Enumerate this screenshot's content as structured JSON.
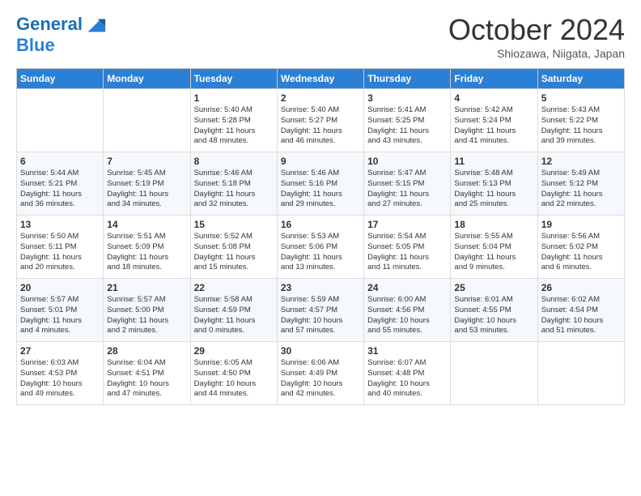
{
  "header": {
    "logo_line1": "General",
    "logo_line2": "Blue",
    "month": "October 2024",
    "location": "Shiozawa, Niigata, Japan"
  },
  "days_of_week": [
    "Sunday",
    "Monday",
    "Tuesday",
    "Wednesday",
    "Thursday",
    "Friday",
    "Saturday"
  ],
  "weeks": [
    [
      {
        "day": "",
        "info": ""
      },
      {
        "day": "",
        "info": ""
      },
      {
        "day": "1",
        "info": "Sunrise: 5:40 AM\nSunset: 5:28 PM\nDaylight: 11 hours\nand 48 minutes."
      },
      {
        "day": "2",
        "info": "Sunrise: 5:40 AM\nSunset: 5:27 PM\nDaylight: 11 hours\nand 46 minutes."
      },
      {
        "day": "3",
        "info": "Sunrise: 5:41 AM\nSunset: 5:25 PM\nDaylight: 11 hours\nand 43 minutes."
      },
      {
        "day": "4",
        "info": "Sunrise: 5:42 AM\nSunset: 5:24 PM\nDaylight: 11 hours\nand 41 minutes."
      },
      {
        "day": "5",
        "info": "Sunrise: 5:43 AM\nSunset: 5:22 PM\nDaylight: 11 hours\nand 39 minutes."
      }
    ],
    [
      {
        "day": "6",
        "info": "Sunrise: 5:44 AM\nSunset: 5:21 PM\nDaylight: 11 hours\nand 36 minutes."
      },
      {
        "day": "7",
        "info": "Sunrise: 5:45 AM\nSunset: 5:19 PM\nDaylight: 11 hours\nand 34 minutes."
      },
      {
        "day": "8",
        "info": "Sunrise: 5:46 AM\nSunset: 5:18 PM\nDaylight: 11 hours\nand 32 minutes."
      },
      {
        "day": "9",
        "info": "Sunrise: 5:46 AM\nSunset: 5:16 PM\nDaylight: 11 hours\nand 29 minutes."
      },
      {
        "day": "10",
        "info": "Sunrise: 5:47 AM\nSunset: 5:15 PM\nDaylight: 11 hours\nand 27 minutes."
      },
      {
        "day": "11",
        "info": "Sunrise: 5:48 AM\nSunset: 5:13 PM\nDaylight: 11 hours\nand 25 minutes."
      },
      {
        "day": "12",
        "info": "Sunrise: 5:49 AM\nSunset: 5:12 PM\nDaylight: 11 hours\nand 22 minutes."
      }
    ],
    [
      {
        "day": "13",
        "info": "Sunrise: 5:50 AM\nSunset: 5:11 PM\nDaylight: 11 hours\nand 20 minutes."
      },
      {
        "day": "14",
        "info": "Sunrise: 5:51 AM\nSunset: 5:09 PM\nDaylight: 11 hours\nand 18 minutes."
      },
      {
        "day": "15",
        "info": "Sunrise: 5:52 AM\nSunset: 5:08 PM\nDaylight: 11 hours\nand 15 minutes."
      },
      {
        "day": "16",
        "info": "Sunrise: 5:53 AM\nSunset: 5:06 PM\nDaylight: 11 hours\nand 13 minutes."
      },
      {
        "day": "17",
        "info": "Sunrise: 5:54 AM\nSunset: 5:05 PM\nDaylight: 11 hours\nand 11 minutes."
      },
      {
        "day": "18",
        "info": "Sunrise: 5:55 AM\nSunset: 5:04 PM\nDaylight: 11 hours\nand 9 minutes."
      },
      {
        "day": "19",
        "info": "Sunrise: 5:56 AM\nSunset: 5:02 PM\nDaylight: 11 hours\nand 6 minutes."
      }
    ],
    [
      {
        "day": "20",
        "info": "Sunrise: 5:57 AM\nSunset: 5:01 PM\nDaylight: 11 hours\nand 4 minutes."
      },
      {
        "day": "21",
        "info": "Sunrise: 5:57 AM\nSunset: 5:00 PM\nDaylight: 11 hours\nand 2 minutes."
      },
      {
        "day": "22",
        "info": "Sunrise: 5:58 AM\nSunset: 4:59 PM\nDaylight: 11 hours\nand 0 minutes."
      },
      {
        "day": "23",
        "info": "Sunrise: 5:59 AM\nSunset: 4:57 PM\nDaylight: 10 hours\nand 57 minutes."
      },
      {
        "day": "24",
        "info": "Sunrise: 6:00 AM\nSunset: 4:56 PM\nDaylight: 10 hours\nand 55 minutes."
      },
      {
        "day": "25",
        "info": "Sunrise: 6:01 AM\nSunset: 4:55 PM\nDaylight: 10 hours\nand 53 minutes."
      },
      {
        "day": "26",
        "info": "Sunrise: 6:02 AM\nSunset: 4:54 PM\nDaylight: 10 hours\nand 51 minutes."
      }
    ],
    [
      {
        "day": "27",
        "info": "Sunrise: 6:03 AM\nSunset: 4:53 PM\nDaylight: 10 hours\nand 49 minutes."
      },
      {
        "day": "28",
        "info": "Sunrise: 6:04 AM\nSunset: 4:51 PM\nDaylight: 10 hours\nand 47 minutes."
      },
      {
        "day": "29",
        "info": "Sunrise: 6:05 AM\nSunset: 4:50 PM\nDaylight: 10 hours\nand 44 minutes."
      },
      {
        "day": "30",
        "info": "Sunrise: 6:06 AM\nSunset: 4:49 PM\nDaylight: 10 hours\nand 42 minutes."
      },
      {
        "day": "31",
        "info": "Sunrise: 6:07 AM\nSunset: 4:48 PM\nDaylight: 10 hours\nand 40 minutes."
      },
      {
        "day": "",
        "info": ""
      },
      {
        "day": "",
        "info": ""
      }
    ]
  ]
}
